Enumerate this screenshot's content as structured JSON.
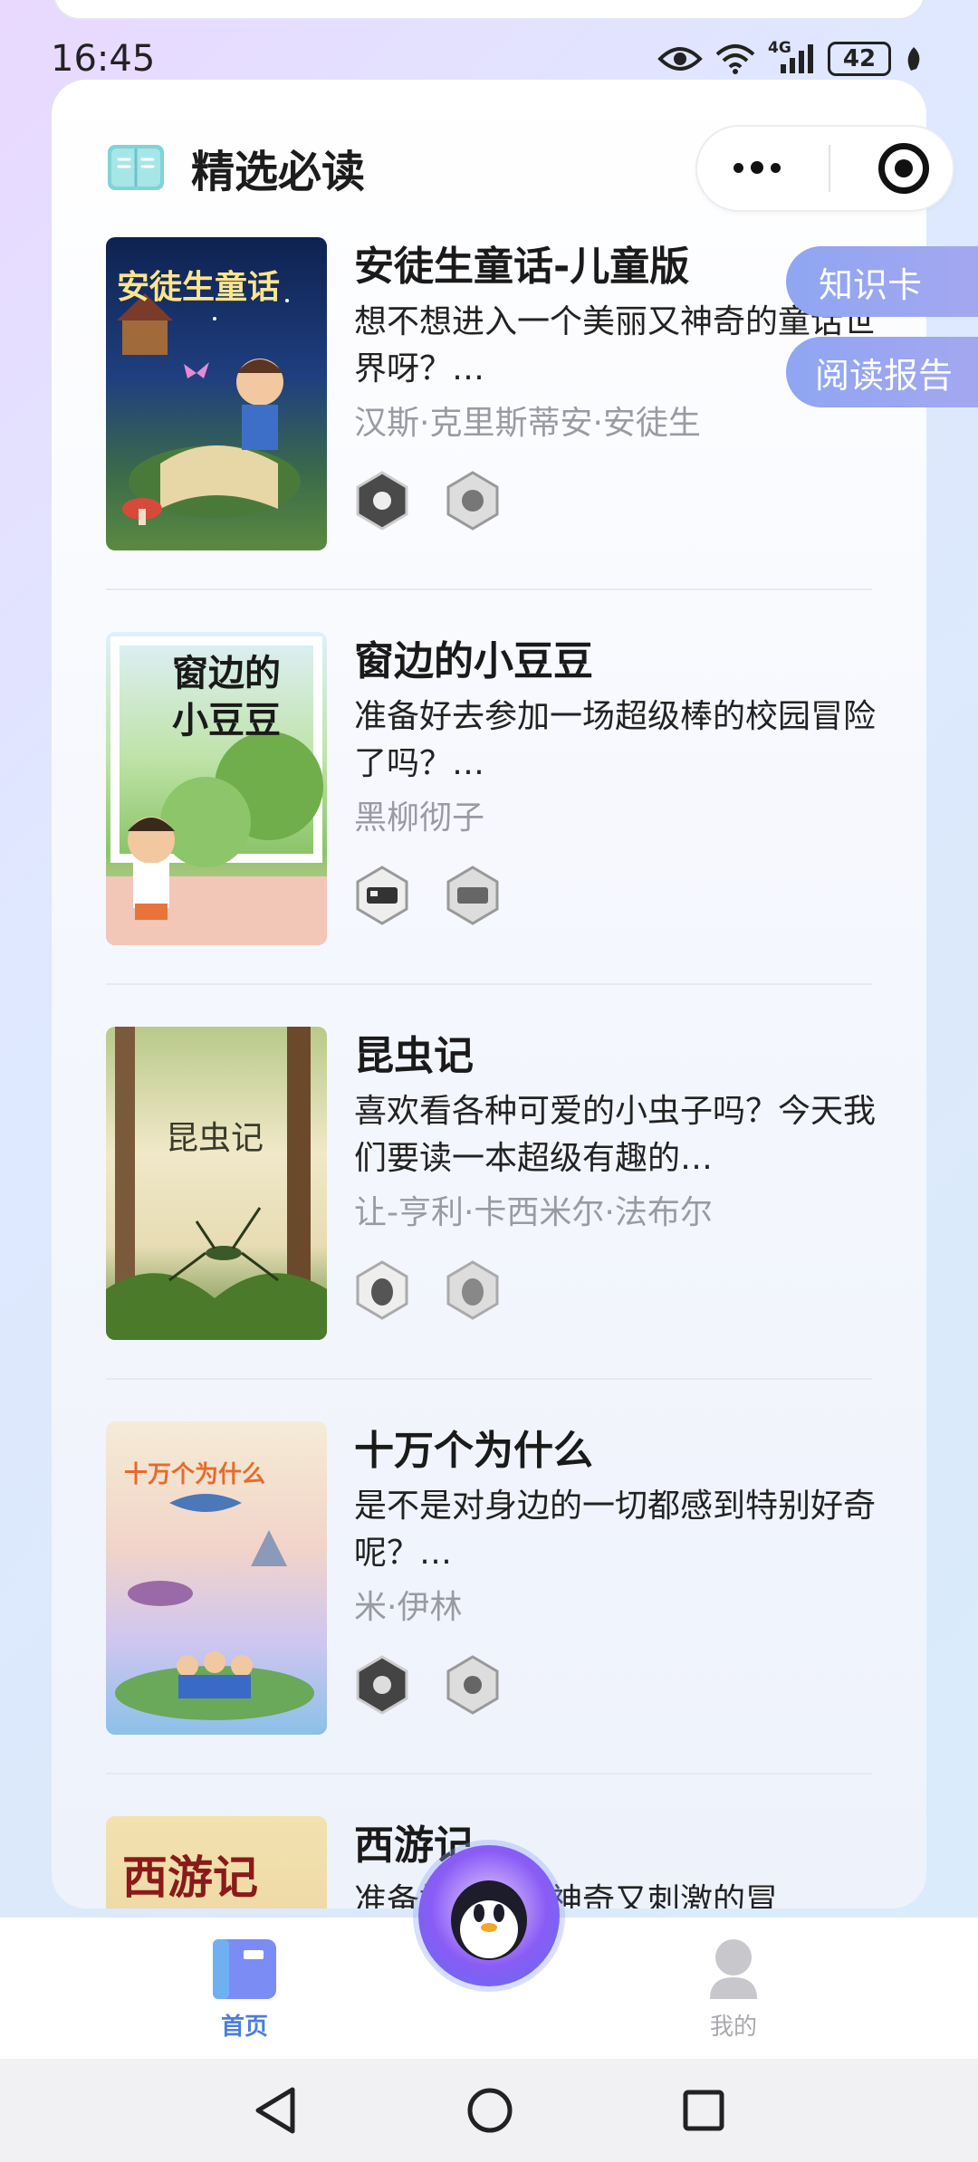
{
  "status": {
    "time": "16:45",
    "network": "4G",
    "battery": "42"
  },
  "header": {
    "title": "精选必读"
  },
  "side_tabs": {
    "knowledge_card": "知识卡",
    "reading_report": "阅读报告"
  },
  "books": [
    {
      "title": "安徒生童话-儿童版",
      "desc": "想不想进入一个美丽又神奇的童话世界呀？…",
      "author": "汉斯·克里斯蒂安·安徒生",
      "cover_text": "安徒生童话"
    },
    {
      "title": "窗边的小豆豆",
      "desc": "准备好去参加一场超级棒的校园冒险了吗？…",
      "author": "黑柳彻子",
      "cover_text": "窗边的小豆豆"
    },
    {
      "title": "昆虫记",
      "desc": "喜欢看各种可爱的小虫子吗？今天我们要读一本超级有趣的…",
      "author": "让-亨利·卡西米尔·法布尔",
      "cover_text": "昆虫记"
    },
    {
      "title": "十万个为什么",
      "desc": "是不是对身边的一切都感到特别好奇呢？…",
      "author": "米·伊林",
      "cover_text": "十万个为什么"
    },
    {
      "title": "西游记",
      "desc": "准备好去一场神奇又刺激的冒",
      "cover_text": "西游记"
    }
  ],
  "bottom_nav": {
    "home": "首页",
    "mine": "我的"
  },
  "colors": {
    "accent": "#4a7de0",
    "tab_gradient_start": "#8fa6f2",
    "inactive": "#a9a9b0"
  }
}
